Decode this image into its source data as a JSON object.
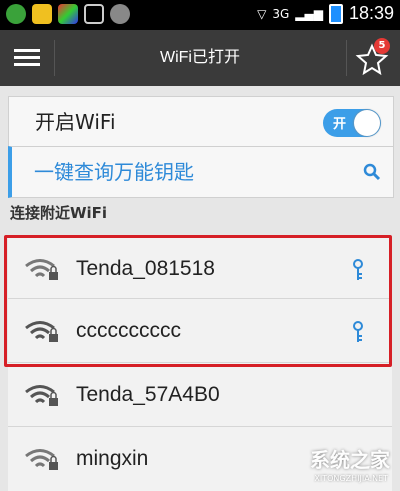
{
  "status_bar": {
    "network": "3G",
    "time": "18:39"
  },
  "header": {
    "title": "WiFi已打开",
    "badge_count": "5"
  },
  "wifi_toggle": {
    "label": "开启WiFi",
    "switch_label": "开"
  },
  "query": {
    "label": "一键查询万能钥匙"
  },
  "section_title": "连接附近WiFi",
  "networks": [
    {
      "ssid": "Tenda_081518",
      "has_key": true
    },
    {
      "ssid": "cccccccccc",
      "has_key": true
    },
    {
      "ssid": "Tenda_57A4B0",
      "has_key": false
    },
    {
      "ssid": "mingxin",
      "has_key": false
    }
  ],
  "colors": {
    "accent": "#3c9ee8",
    "highlight": "#d61f26"
  },
  "watermark": {
    "text": "系统之家",
    "sub": "XITONGZHIJIA.NET"
  }
}
